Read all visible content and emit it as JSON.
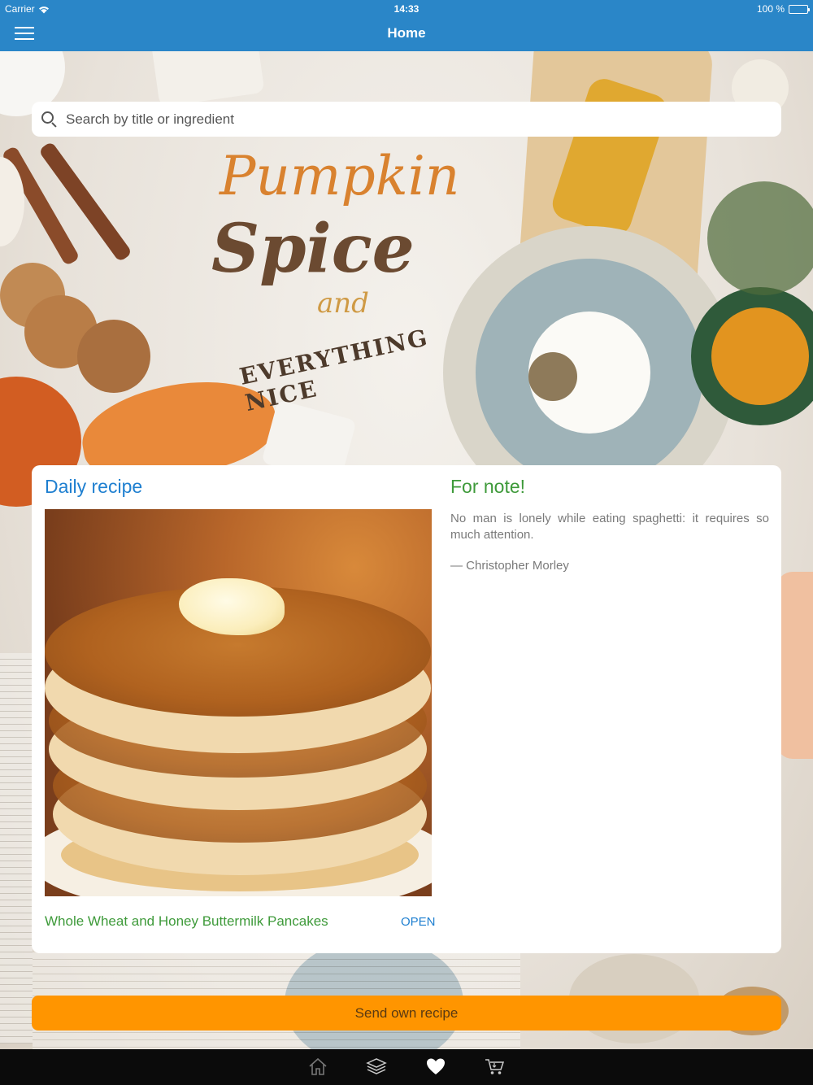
{
  "status_bar": {
    "carrier": "Carrier",
    "time": "14:33",
    "battery": "100 %",
    "battery_level": 1.0
  },
  "nav": {
    "title": "Home",
    "menu_icon": "hamburger-menu-icon"
  },
  "search": {
    "placeholder": "Search by title or ingredient",
    "value": "",
    "icon": "search-icon"
  },
  "background": {
    "headline_lines": [
      "Pumpkin",
      "Spice",
      "and",
      "EVERYTHING NICE"
    ]
  },
  "daily_recipe": {
    "heading": "Daily recipe",
    "recipe_name": "Whole Wheat and Honey Buttermilk Pancakes",
    "open_label": "OPEN"
  },
  "note": {
    "heading": "For note!",
    "quote": "No man is lonely while eating spaghetti: it requires so much attention.",
    "author": "— Christopher Morley"
  },
  "send_button": {
    "label": "Send own recipe"
  },
  "tab_bar": {
    "tabs": [
      {
        "icon": "home-icon",
        "active": false
      },
      {
        "icon": "layers-icon",
        "active": false
      },
      {
        "icon": "heart-icon",
        "active": true
      },
      {
        "icon": "cart-icon",
        "active": false
      }
    ]
  },
  "colors": {
    "nav_blue": "#2a86c8",
    "link_blue": "#1e7fd0",
    "green": "#3e9a3a",
    "orange": "#ff9500",
    "tab_bar": "#0b0b0b"
  }
}
